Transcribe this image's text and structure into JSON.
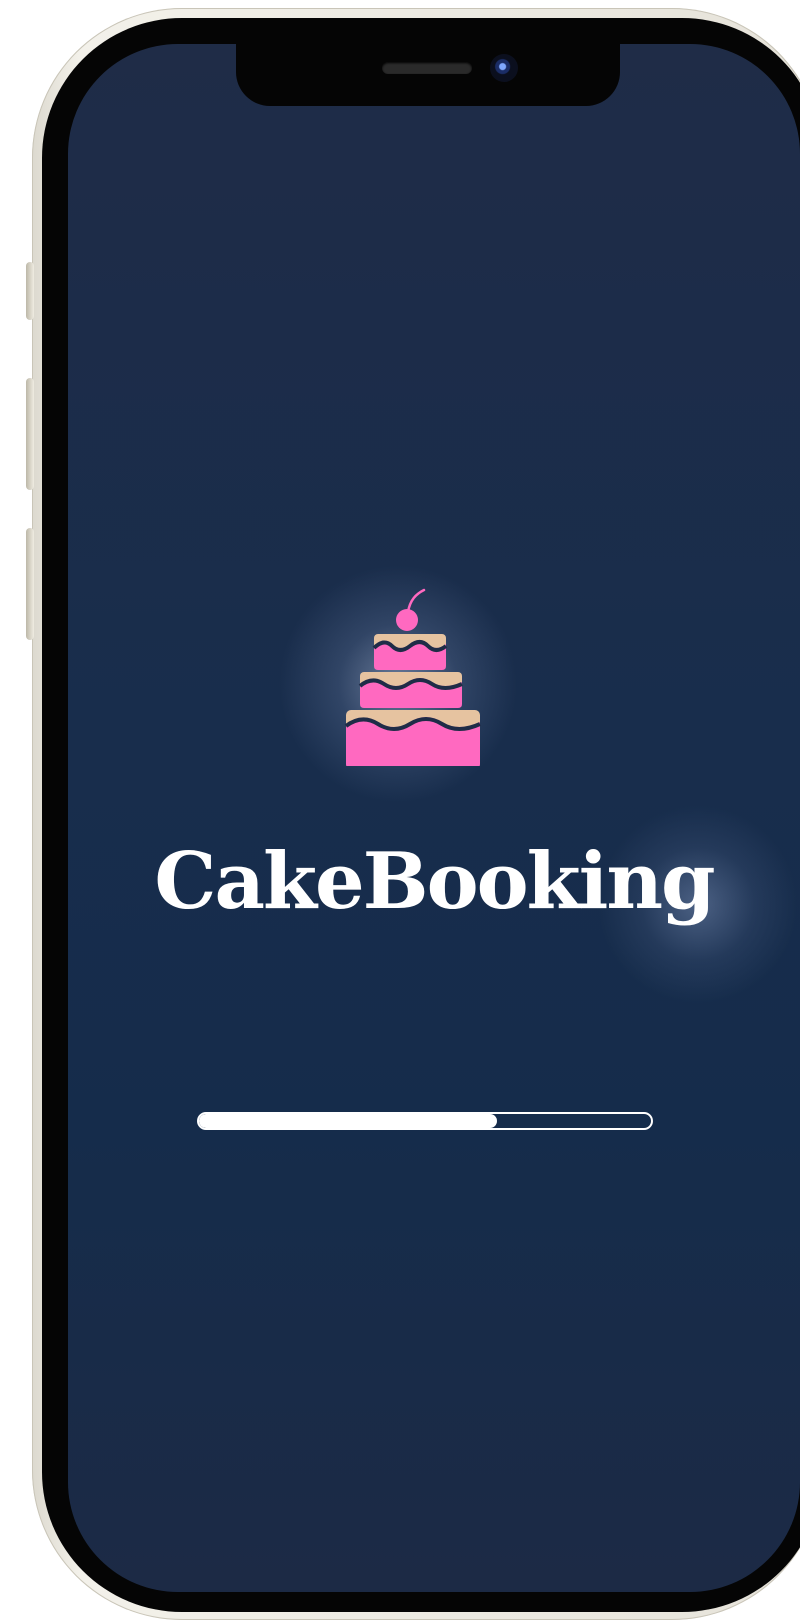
{
  "app": {
    "title": "CakeBooking"
  },
  "logo": {
    "icon": "cake-icon",
    "colors": {
      "pink": "#ff69c0",
      "cream": "#e6c3a0",
      "chocolate": "#1f2c47"
    }
  },
  "loading": {
    "progress_percent": 66
  },
  "colors": {
    "background": "#182d4c",
    "text": "#ffffff"
  }
}
